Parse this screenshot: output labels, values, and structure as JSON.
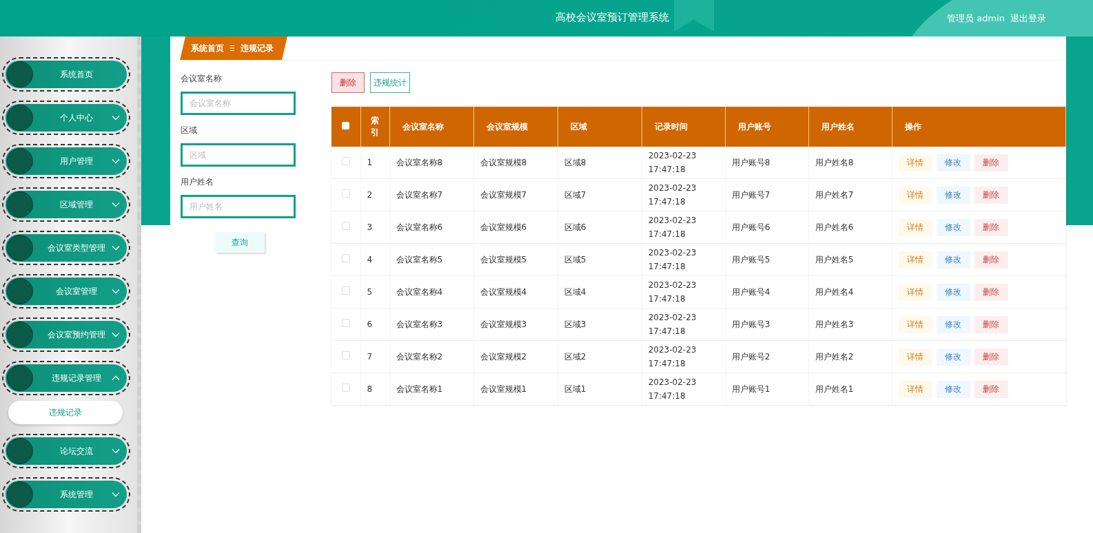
{
  "header": {
    "title": "高校会议室预订管理系统",
    "user": "管理员 admin",
    "logout": "退出登录"
  },
  "sidebar": {
    "items": [
      {
        "label": "系统首页",
        "kind": "link"
      },
      {
        "label": "个人中心",
        "kind": "menu",
        "expanded": false
      },
      {
        "label": "用户管理",
        "kind": "menu",
        "expanded": false
      },
      {
        "label": "区域管理",
        "kind": "menu",
        "expanded": false
      },
      {
        "label": "会议室类型管理",
        "kind": "menu",
        "expanded": false
      },
      {
        "label": "会议室管理",
        "kind": "menu",
        "expanded": false
      },
      {
        "label": "会议室预约管理",
        "kind": "menu",
        "expanded": false
      },
      {
        "label": "违规记录管理",
        "kind": "menu",
        "expanded": true,
        "children": [
          {
            "label": "违规记录"
          }
        ]
      },
      {
        "label": "论坛交流",
        "kind": "menu",
        "expanded": false
      },
      {
        "label": "系统管理",
        "kind": "menu",
        "expanded": false
      }
    ]
  },
  "breadcrumb": [
    "系统首页",
    "违规记录"
  ],
  "search": {
    "fields": [
      {
        "label": "会议室名称",
        "placeholder": "会议室名称"
      },
      {
        "label": "区域",
        "placeholder": "区域"
      },
      {
        "label": "用户姓名",
        "placeholder": "用户姓名"
      }
    ],
    "button": "查询"
  },
  "actions": [
    {
      "label": "删除",
      "kind": "danger"
    },
    {
      "label": "违规统计",
      "kind": "outline"
    }
  ],
  "table": {
    "select_all_checked": false,
    "columns": [
      "索引",
      "会议室名称",
      "会议室规模",
      "区域",
      "记录时间",
      "用户账号",
      "用户姓名",
      "操作"
    ],
    "rows": [
      {
        "checked": false,
        "cells": [
          "1",
          "会议室名称8",
          "会议室规模8",
          "区域8",
          "2023-02-23 17:47:18",
          "用户账号8",
          "用户姓名8"
        ],
        "actions": [
          {
            "label": "详情",
            "kind": "detail"
          },
          {
            "label": "修改",
            "kind": "edit"
          },
          {
            "label": "删除",
            "kind": "delete"
          }
        ]
      },
      {
        "checked": false,
        "cells": [
          "2",
          "会议室名称7",
          "会议室规模7",
          "区域7",
          "2023-02-23 17:47:18",
          "用户账号7",
          "用户姓名7"
        ],
        "actions": [
          {
            "label": "详情",
            "kind": "detail"
          },
          {
            "label": "修改",
            "kind": "edit"
          },
          {
            "label": "删除",
            "kind": "delete"
          }
        ]
      },
      {
        "checked": false,
        "cells": [
          "3",
          "会议室名称6",
          "会议室规模6",
          "区域6",
          "2023-02-23 17:47:18",
          "用户账号6",
          "用户姓名6"
        ],
        "actions": [
          {
            "label": "详情",
            "kind": "detail"
          },
          {
            "label": "修改",
            "kind": "edit"
          },
          {
            "label": "删除",
            "kind": "delete"
          }
        ]
      },
      {
        "checked": false,
        "cells": [
          "4",
          "会议室名称5",
          "会议室规模5",
          "区域5",
          "2023-02-23 17:47:18",
          "用户账号5",
          "用户姓名5"
        ],
        "actions": [
          {
            "label": "详情",
            "kind": "detail"
          },
          {
            "label": "修改",
            "kind": "edit"
          },
          {
            "label": "删除",
            "kind": "delete"
          }
        ]
      },
      {
        "checked": false,
        "cells": [
          "5",
          "会议室名称4",
          "会议室规模4",
          "区域4",
          "2023-02-23 17:47:18",
          "用户账号4",
          "用户姓名4"
        ],
        "actions": [
          {
            "label": "详情",
            "kind": "detail"
          },
          {
            "label": "修改",
            "kind": "edit"
          },
          {
            "label": "删除",
            "kind": "delete"
          }
        ]
      },
      {
        "checked": false,
        "cells": [
          "6",
          "会议室名称3",
          "会议室规模3",
          "区域3",
          "2023-02-23 17:47:18",
          "用户账号3",
          "用户姓名3"
        ],
        "actions": [
          {
            "label": "详情",
            "kind": "detail"
          },
          {
            "label": "修改",
            "kind": "edit"
          },
          {
            "label": "删除",
            "kind": "delete"
          }
        ]
      },
      {
        "checked": false,
        "cells": [
          "7",
          "会议室名称2",
          "会议室规模2",
          "区域2",
          "2023-02-23 17:47:18",
          "用户账号2",
          "用户姓名2"
        ],
        "actions": [
          {
            "label": "详情",
            "kind": "detail"
          },
          {
            "label": "修改",
            "kind": "edit"
          },
          {
            "label": "删除",
            "kind": "delete"
          }
        ]
      },
      {
        "checked": false,
        "cells": [
          "8",
          "会议室名称1",
          "会议室规模1",
          "区域1",
          "2023-02-23 17:47:18",
          "用户账号1",
          "用户姓名1"
        ],
        "actions": [
          {
            "label": "详情",
            "kind": "detail"
          },
          {
            "label": "修改",
            "kind": "edit"
          },
          {
            "label": "删除",
            "kind": "delete"
          }
        ]
      }
    ]
  }
}
